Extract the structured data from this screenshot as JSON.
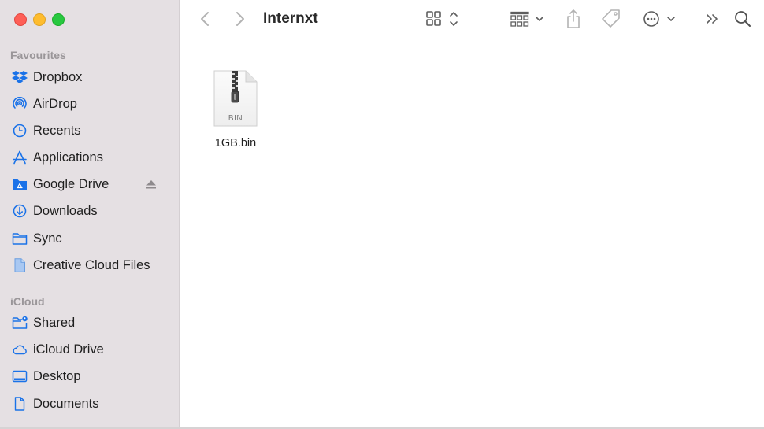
{
  "window": {
    "title": "Internxt"
  },
  "sidebar": {
    "sections": [
      {
        "title": "Favourites",
        "items": [
          {
            "label": "Dropbox",
            "icon": "dropbox-icon"
          },
          {
            "label": "AirDrop",
            "icon": "airdrop-icon"
          },
          {
            "label": "Recents",
            "icon": "clock-icon"
          },
          {
            "label": "Applications",
            "icon": "applications-icon"
          },
          {
            "label": "Google Drive",
            "icon": "google-drive-folder-icon"
          },
          {
            "label": "Downloads",
            "icon": "download-icon"
          },
          {
            "label": "Sync",
            "icon": "folder-icon"
          },
          {
            "label": "Creative Cloud Files",
            "icon": "document-icon"
          }
        ]
      },
      {
        "title": "iCloud",
        "items": [
          {
            "label": "Shared",
            "icon": "shared-folder-icon"
          },
          {
            "label": "iCloud Drive",
            "icon": "cloud-icon"
          },
          {
            "label": "Desktop",
            "icon": "desktop-icon"
          },
          {
            "label": "Documents",
            "icon": "document-icon"
          }
        ]
      }
    ]
  },
  "files": [
    {
      "name": "1GB.bin",
      "extension": "BIN",
      "icon": "zip-archive-icon"
    }
  ],
  "colors": {
    "sidebar_bg": "#e5e0e3",
    "accent": "#1a72e8",
    "close": "#fe5f57",
    "minimize": "#febc2e",
    "maximize": "#28c840"
  }
}
